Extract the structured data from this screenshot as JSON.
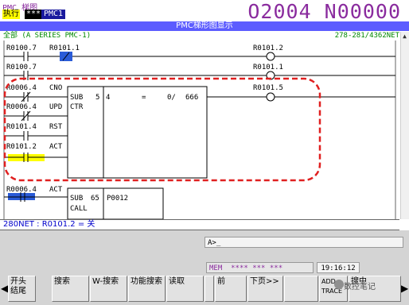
{
  "header": {
    "screen_label": "PMC 梯图",
    "mode": "执行",
    "mode_indicator": "***",
    "module": "PMC1",
    "program_block": "O2004 N00000"
  },
  "window": {
    "title": "PMC梯形图显示",
    "scope": "全部 (A SERIES PMC-1)",
    "net_count": "278-281/4362NET"
  },
  "ladder": {
    "rows": [
      {
        "contacts": [
          "R0100.7",
          "R0101.1"
        ],
        "coil": "R0101.2"
      },
      {
        "contacts": [
          "R0100.7"
        ],
        "coil": "R0101.1"
      },
      {
        "func": {
          "number": "5",
          "name": "CTR",
          "inputs": [
            "CNO",
            "UPD",
            "RST",
            "ACT"
          ],
          "input_addrs": [
            "R0006.4",
            "R0006.4",
            "R0101.4",
            "R0101.2"
          ],
          "param": "4",
          "eq": "=",
          "value": "0/",
          "preset": "666"
        },
        "coil": "R0101.5"
      },
      {
        "func": {
          "number": "65",
          "name": "CALL",
          "inputs": [
            "ACT"
          ],
          "input_addrs": [
            "R0006.4"
          ],
          "param": "P0012"
        }
      }
    ],
    "sub_label": "SUB",
    "highlight_color": "#e02020",
    "active_contact_color": "#ffff00",
    "energized_contact_color": "#2a5bd7"
  },
  "status": {
    "text": "280NET : R0101.2 = 关"
  },
  "input": {
    "prompt": "A>_"
  },
  "mode_status": {
    "mode": "MEM",
    "stars": "**** *** ***",
    "clock": "19:16:12"
  },
  "softkeys": [
    {
      "label": "开头结尾"
    },
    {
      "label": "搜索"
    },
    {
      "label": "W-搜索"
    },
    {
      "label": "功能搜索"
    },
    {
      "label": "读取"
    },
    {
      "label": ""
    },
    {
      "label": "前"
    },
    {
      "label": "下页>>"
    },
    {
      "label": ""
    },
    {
      "label": "ADD TRACE"
    },
    {
      "label": "搜中"
    }
  ],
  "watermark": "数控笔记"
}
